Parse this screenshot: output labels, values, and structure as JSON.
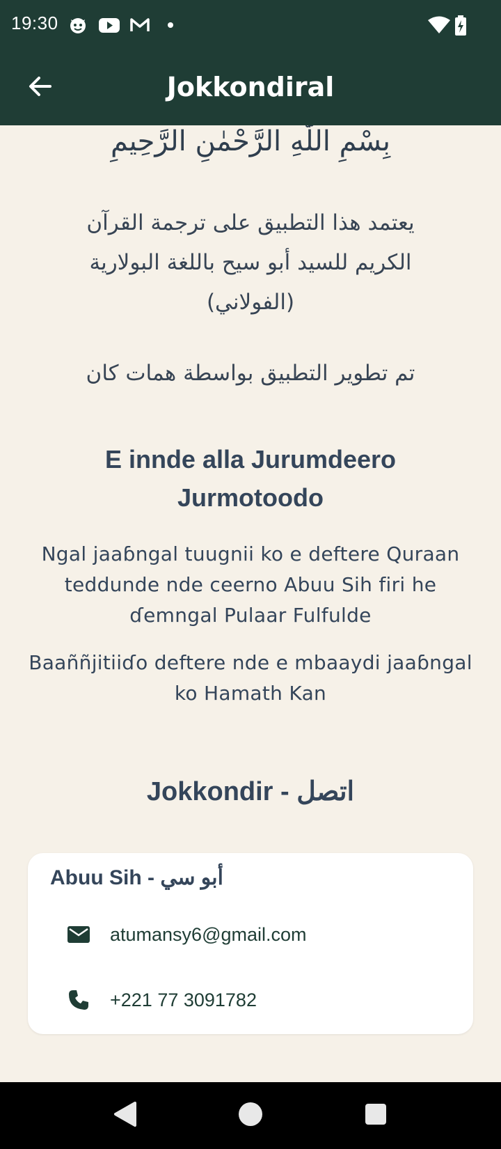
{
  "status_bar": {
    "time": "19:30",
    "left_icons": [
      "cat-notification-icon",
      "youtube-icon",
      "gmail-icon",
      "dot-icon"
    ],
    "right_icons": [
      "wifi-icon",
      "battery-charging-icon"
    ]
  },
  "app_bar": {
    "title": "Jokkondiral",
    "back_icon": "arrow-back-icon"
  },
  "content": {
    "basmala": "بِسْمِ اللّٰهِ الرَّحْمٰنِ الرَّحِيمِ",
    "arabic_intro": "يعتمد هذا التطبيق على ترجمة القرآن الكريم للسيد أبو سيح باللغة البولارية (الفولاني)",
    "arabic_developer": "تم تطوير التطبيق بواسطة همات كان",
    "heading": "E innde alla Jurumdeero Jurmotoodo",
    "para_intro": "Ngal jaaɓngal tuugnii ko e deftere Quraan teddunde nde ceerno Abuu Sih firi he ɗemngal Pulaar Fulfulde",
    "para_developer": "Baaññjitiiɗo deftere nde e mbaaydi jaaɓngal ko Hamath Kan",
    "contact_heading": "Jokkondir - اتصل"
  },
  "contact_card": {
    "name": "Abuu Sih - أبو سي",
    "email": "atumansy6@gmail.com",
    "phone": "+221 77 3091782",
    "email_icon": "email-icon",
    "phone_icon": "phone-icon"
  },
  "nav_bar": {
    "buttons": [
      "back-nav-icon",
      "home-nav-icon",
      "recents-nav-icon"
    ]
  },
  "colors": {
    "primary": "#1f3d35",
    "background": "#f6f1e8",
    "text": "#34455a",
    "card": "#ffffff"
  }
}
